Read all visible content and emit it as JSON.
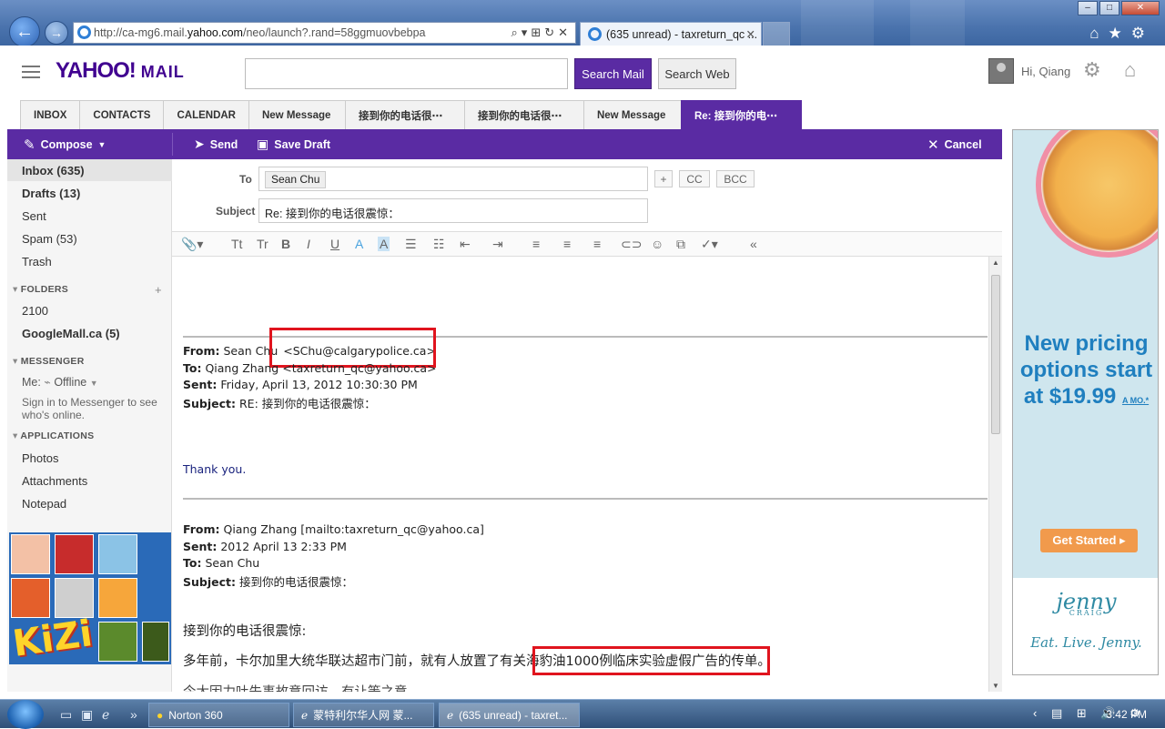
{
  "browser": {
    "url_prefix": "http://ca-mg6.mail.",
    "url_domain": "yahoo.com",
    "url_suffix": "/neo/launch?.rand=58ggmuovbebpa",
    "tab_title": "(635 unread) - taxreturn_qc ..."
  },
  "header": {
    "logo": "YAHOO!",
    "logo_sub": "MAIL",
    "search_placeholder": "",
    "search_mail": "Search Mail",
    "search_web": "Search Web",
    "greeting": "Hi, Qiang"
  },
  "tabs": [
    {
      "label": "INBOX"
    },
    {
      "label": "CONTACTS"
    },
    {
      "label": "CALENDAR"
    },
    {
      "label": "New Message"
    },
    {
      "label": "接到你的电话很⋯"
    },
    {
      "label": "接到你的电话很⋯"
    },
    {
      "label": "New Message"
    },
    {
      "label": "Re: 接到你的电⋯"
    }
  ],
  "toolbar": {
    "compose": "Compose",
    "send": "Send",
    "save_draft": "Save Draft",
    "cancel": "Cancel"
  },
  "sidebar": {
    "items": [
      "Inbox (635)",
      "Drafts (13)",
      "Sent",
      "Spam (53)",
      "Trash"
    ],
    "folders_head": "FOLDERS",
    "folders": [
      "2100",
      "GoogleMall.ca (5)"
    ],
    "messenger_head": "MESSENGER",
    "me": "Me:",
    "status": "Offline",
    "messenger_note": "Sign in to Messenger to see who's online.",
    "apps_head": "APPLICATIONS",
    "apps": [
      "Photos",
      "Attachments",
      "Notepad"
    ],
    "game_logo": "KiZi"
  },
  "compose": {
    "to_label": "To",
    "to_chip": "Sean Chu",
    "plus": "+",
    "cc": "CC",
    "bcc": "BCC",
    "subject_label": "Subject",
    "subject": "Re: 接到你的电话很震惊："
  },
  "message": {
    "q1_from_label": "From:",
    "q1_from_name": "Sean Chu",
    "q1_from_email": "<SChu@calgarypolice.ca>",
    "q1_to_label": "To:",
    "q1_to": "Qiang Zhang <taxreturn_qc@yahoo.ca>",
    "q1_sent_label": "Sent:",
    "q1_sent": "Friday, April 13, 2012 10:30:30 PM",
    "q1_subject_label": "Subject:",
    "q1_subject": "RE: 接到你的电话很震惊：",
    "thanks": "Thank you.",
    "q2_from_label": "From:",
    "q2_from": "Qiang Zhang [mailto:taxreturn_qc@yahoo.ca]",
    "q2_sent_label": "Sent:",
    "q2_sent": "2012 April 13 2:33 PM",
    "q2_to_label": "To:",
    "q2_to": "Sean Chu",
    "q2_subject_label": "Subject:",
    "q2_subject": "接到你的电话很震惊：",
    "para1": "接到你的电话很震惊:",
    "para2_a": "多年前，卡尔加里大统华联达超市门前，就有人放置了",
    "para2_b": "有关海豹油1000例临床实验虚假广告",
    "para2_c": "的传单。",
    "para3": "今⼤因力吐失事故意回访，有让等之意"
  },
  "ad": {
    "headline": "New pricing options start at $19.99",
    "suffix": "A MO.*",
    "button": "Get Started ▸",
    "brand": "jenny",
    "brand_sub": "CRAIG",
    "tagline": "Eat. Live. Jenny."
  },
  "taskbar": {
    "items": [
      "Norton 360",
      "蒙特利尔华人网 蒙...",
      "(635 unread) - taxret..."
    ],
    "time": "3:42 PM"
  },
  "colors": {
    "yahoo_purple": "#5a2ba3",
    "annotation_red": "#e0141e"
  }
}
